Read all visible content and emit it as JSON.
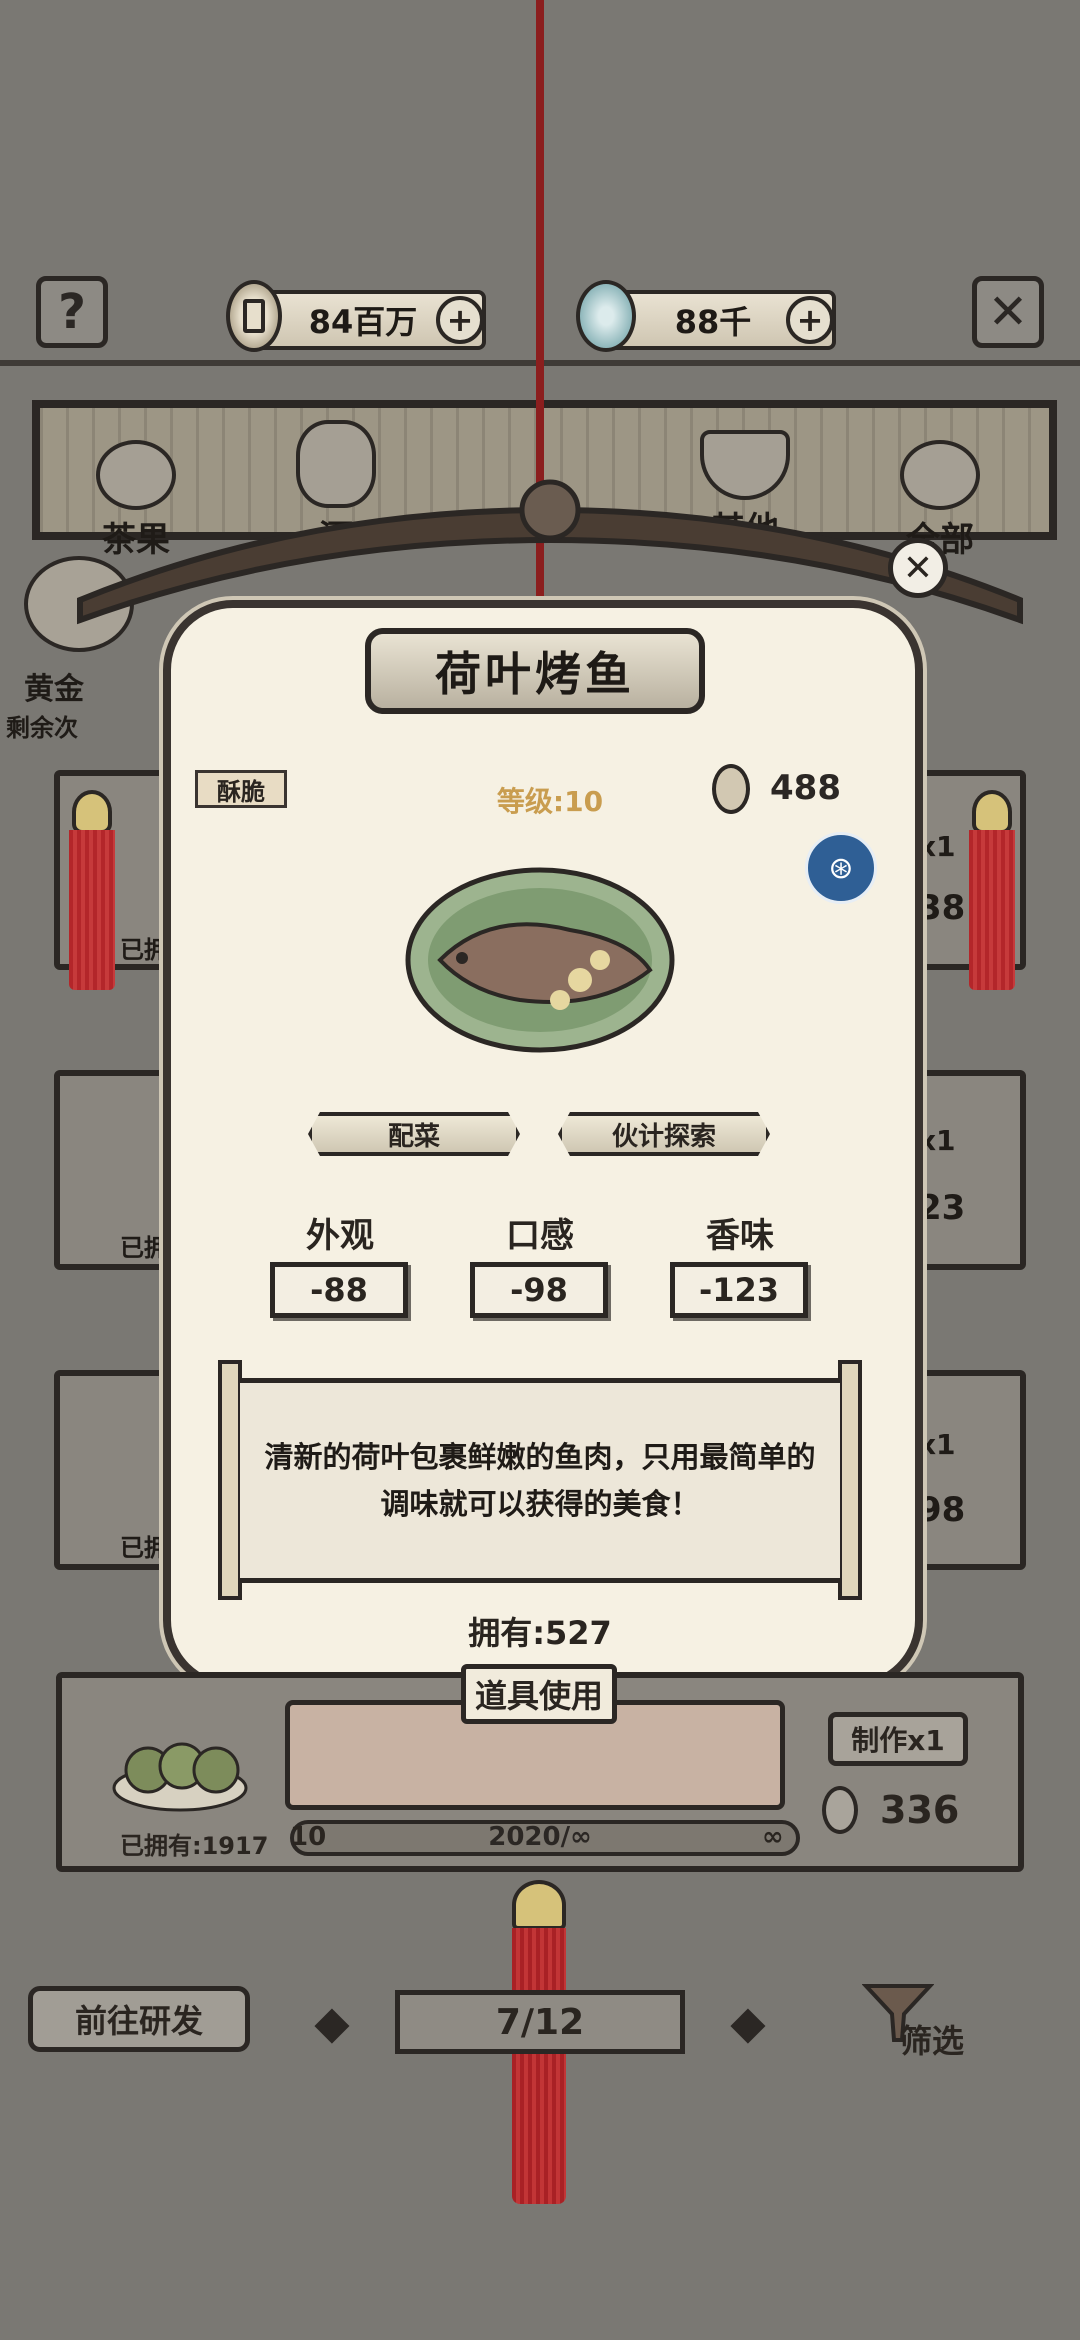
{
  "currency": {
    "coins": "84百万",
    "gems": "88千"
  },
  "categories": [
    {
      "label": "茶果"
    },
    {
      "label": "酒"
    },
    {
      "label": "其他"
    },
    {
      "label": "全部"
    }
  ],
  "background_list": {
    "left_category_label": "黄金",
    "remaining_label": "剩余次",
    "owned_partial": "已拥",
    "right_fragments": [
      "x1",
      "38",
      "x1",
      "23",
      "x1",
      "98"
    ]
  },
  "detail": {
    "title": "荷叶烤鱼",
    "tag": "酥脆",
    "level": "等级:10",
    "price": "488",
    "buttons": {
      "side_dish": "配菜",
      "partner_explore": "伙计探索"
    },
    "stats": [
      {
        "label": "外观",
        "value": "-88"
      },
      {
        "label": "口感",
        "value": "-98"
      },
      {
        "label": "香味",
        "value": "-123"
      }
    ],
    "description": "清新的荷叶包裹鲜嫩的鱼肉，只用最简单的调味就可以获得的美食！",
    "owned": "拥有:527",
    "use_button": "道具使用"
  },
  "bottom_item": {
    "owned": "已拥有:1917",
    "make_button": "制作x1",
    "price": "336",
    "slider_min": "10",
    "slider_value": "2020/∞",
    "slider_max": "∞"
  },
  "footer": {
    "goto_research": "前往研发",
    "page": "7/12",
    "filter": "筛选"
  },
  "colors": {
    "background": "#7a7873",
    "card": "#f6f1e3",
    "tassel_red": "#b3262a",
    "level_gold": "#c99d4f",
    "badge_blue": "#2f5f95"
  }
}
